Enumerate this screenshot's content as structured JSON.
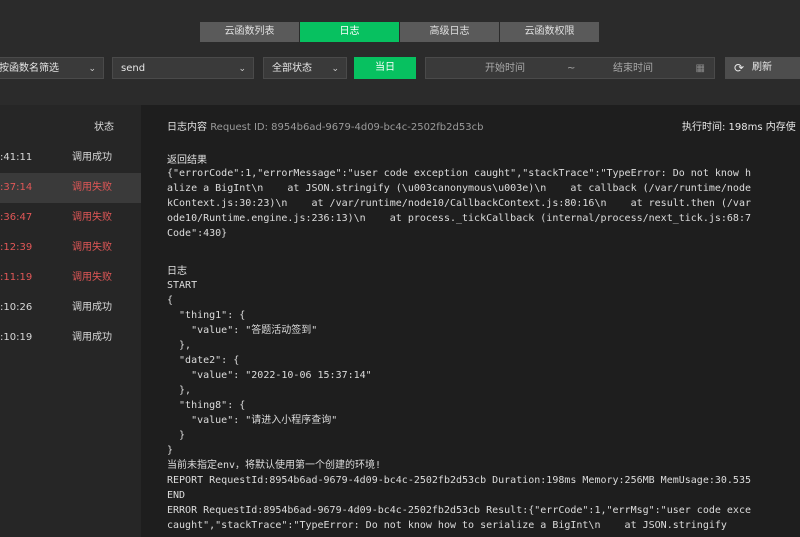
{
  "tabs": [
    {
      "label": "云函数列表",
      "active": false
    },
    {
      "label": "日志",
      "active": true
    },
    {
      "label": "高级日志",
      "active": false
    },
    {
      "label": "云函数权限",
      "active": false
    }
  ],
  "filters": {
    "function_filter": "按函数名筛选",
    "function_name": "send",
    "status": "全部状态",
    "today": "当日",
    "start_time": "开始时间",
    "separator": "~",
    "end_time": "结束时间",
    "refresh": "刷新"
  },
  "icons": {
    "chevron": "chevron-down-icon",
    "calendar": "calendar-icon",
    "refresh": "refresh-icon"
  },
  "colors": {
    "accent": "#07c160",
    "fail": "#e05757"
  },
  "log_list": {
    "header": "状态",
    "rows": [
      {
        "time": ":41:11",
        "status": "调用成功",
        "failed": false
      },
      {
        "time": ":37:14",
        "status": "调用失败",
        "failed": true
      },
      {
        "time": ":36:47",
        "status": "调用失败",
        "failed": true
      },
      {
        "time": ":12:39",
        "status": "调用失败",
        "failed": true
      },
      {
        "time": ":11:19",
        "status": "调用失败",
        "failed": true
      },
      {
        "time": ":10:26",
        "status": "调用成功",
        "failed": false
      },
      {
        "time": ":10:19",
        "status": "调用成功",
        "failed": false
      }
    ]
  },
  "detail": {
    "title": "日志内容",
    "request_id": "Request ID: 8954b6ad-9679-4d09-bc4c-2502fb2d53cb",
    "exec_time": "执行时间: 198ms  内存使",
    "result_label": "返回结果",
    "result_text": "{\"errorCode\":1,\"errorMessage\":\"user code exception caught\",\"stackTrace\":\"TypeError: Do not know h\nalize a BigInt\\n    at JSON.stringify (\\u003canonymous\\u003e)\\n    at callback (/var/runtime/node\nkContext.js:30:23)\\n    at /var/runtime/node10/CallbackContext.js:80:16\\n    at result.then (/var\node10/Runtime.engine.js:236:13)\\n    at process._tickCallback (internal/process/next_tick.js:68:7\nCode\":430}",
    "log_label": "日志",
    "log_text": "START\n{\n  \"thing1\": {\n    \"value\": \"答题活动签到\"\n  },\n  \"date2\": {\n    \"value\": \"2022-10-06 15:37:14\"\n  },\n  \"thing8\": {\n    \"value\": \"请进入小程序查询\"\n  }\n}\n当前未指定env，将默认使用第一个创建的环境!\nREPORT RequestId:8954b6ad-9679-4d09-bc4c-2502fb2d53cb Duration:198ms Memory:256MB MemUsage:30.535\nEND\nERROR RequestId:8954b6ad-9679-4d09-bc4c-2502fb2d53cb Result:{\"errCode\":1,\"errMsg\":\"user code exce\ncaught\",\"stackTrace\":\"TypeError: Do not know how to serialize a BigInt\\n    at JSON.stringify"
  }
}
